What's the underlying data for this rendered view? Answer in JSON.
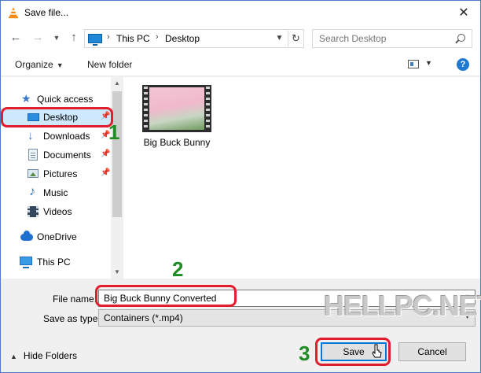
{
  "window": {
    "title": "Save file..."
  },
  "nav": {
    "back_icon": "arrow-left-icon",
    "forward_icon": "arrow-right-icon",
    "recent_icon": "chevron-down-icon",
    "up_icon": "arrow-up-icon",
    "breadcrumb": [
      "This PC",
      "Desktop"
    ],
    "search_placeholder": "Search Desktop"
  },
  "toolbar": {
    "organize_label": "Organize",
    "new_folder_label": "New folder"
  },
  "sidebar": {
    "items": [
      {
        "label": "Quick access",
        "icon": "star-icon",
        "pinned": false
      },
      {
        "label": "Desktop",
        "icon": "desktop-icon",
        "pinned": true,
        "selected": true
      },
      {
        "label": "Downloads",
        "icon": "download-icon",
        "pinned": true
      },
      {
        "label": "Documents",
        "icon": "document-icon",
        "pinned": true
      },
      {
        "label": "Pictures",
        "icon": "picture-icon",
        "pinned": true
      },
      {
        "label": "Music",
        "icon": "music-icon",
        "pinned": false
      },
      {
        "label": "Videos",
        "icon": "video-icon",
        "pinned": false
      },
      {
        "label": "OneDrive",
        "icon": "cloud-icon",
        "pinned": false
      },
      {
        "label": "This PC",
        "icon": "computer-icon",
        "pinned": false
      }
    ]
  },
  "files": [
    {
      "name": "Big Buck Bunny",
      "type": "video-thumbnail"
    }
  ],
  "form": {
    "filename_label": "File name:",
    "filename_value": "Big Buck Bunny Converted",
    "savetype_label": "Save as type:",
    "savetype_value": "Containers (*.mp4)"
  },
  "footer": {
    "hide_folders_label": "Hide Folders",
    "save_label": "Save",
    "cancel_label": "Cancel"
  },
  "annotations": {
    "step1": "1",
    "step2": "2",
    "step3": "3",
    "ring_color": "#e01e2e",
    "number_color": "#1e8c22"
  },
  "watermark": "HELLPC.NET"
}
